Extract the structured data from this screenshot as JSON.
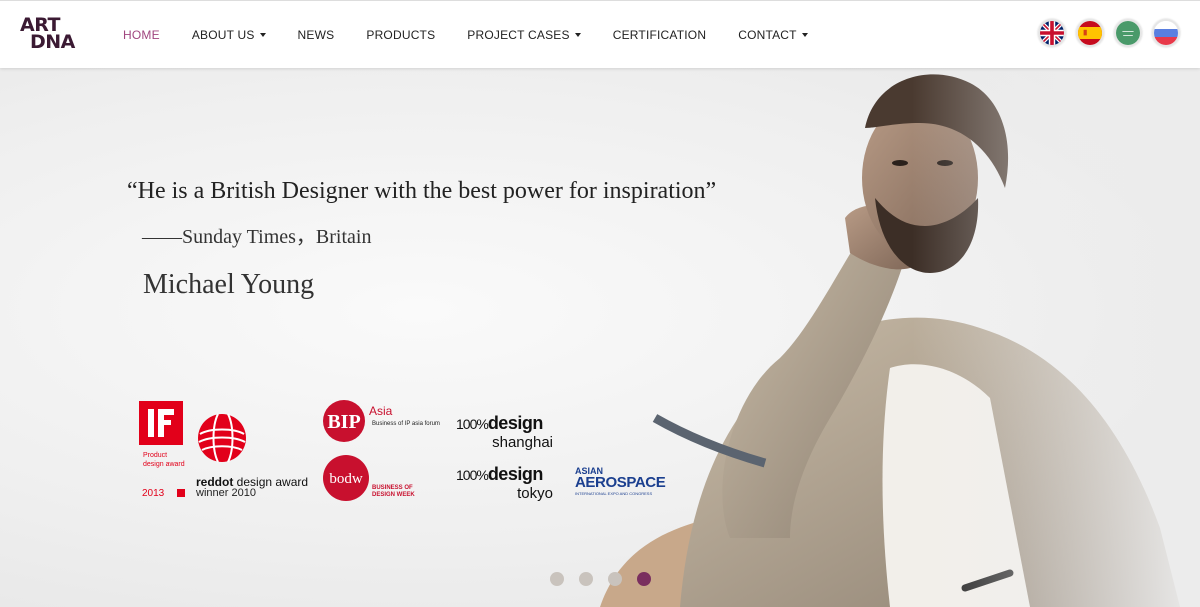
{
  "logo": {
    "line1": "ART",
    "line2": "DNA"
  },
  "nav": {
    "items": [
      {
        "label": "HOME",
        "active": true,
        "dropdown": false
      },
      {
        "label": "ABOUT US",
        "active": false,
        "dropdown": true
      },
      {
        "label": "NEWS",
        "active": false,
        "dropdown": false
      },
      {
        "label": "PRODUCTS",
        "active": false,
        "dropdown": false
      },
      {
        "label": "PROJECT CASES",
        "active": false,
        "dropdown": true
      },
      {
        "label": "CERTIFICATION",
        "active": false,
        "dropdown": false
      },
      {
        "label": "CONTACT",
        "active": false,
        "dropdown": true
      }
    ],
    "active_color": "#a0467f"
  },
  "languages": [
    {
      "name": "uk-flag-icon"
    },
    {
      "name": "spain-flag-icon"
    },
    {
      "name": "saudi-flag-icon"
    },
    {
      "name": "russia-flag-icon"
    }
  ],
  "hero": {
    "quote": "“He is a British Designer with the best power for inspiration”",
    "source": "——Sunday Times，Britain",
    "designer": "Michael Young"
  },
  "awards": {
    "if": {
      "logo": "iF",
      "caption_line1": "Product",
      "caption_line2": "design award",
      "year": "2013"
    },
    "reddot": {
      "title_bold": "reddot",
      "title_rest": " design award",
      "subtitle": "winner 2010"
    },
    "bip": {
      "logo": "BIP",
      "suffix": "Asia",
      "caption": "Business of IP asia forum"
    },
    "bodw": {
      "logo": "bodw",
      "caption_line1": "BUSINESS OF",
      "caption_line2": "DESIGN WEEK"
    },
    "design_shanghai": {
      "prefix": "100%",
      "word": "design",
      "city": "shanghai"
    },
    "design_tokyo": {
      "prefix": "100%",
      "word": "design",
      "city": "tokyo"
    },
    "aerospace": {
      "top": "ASIAN",
      "main": "AEROSPACE",
      "sub": "INTERNATIONAL EXPO AND CONGRESS"
    }
  },
  "carousel": {
    "total": 4,
    "active_index": 3
  },
  "colors": {
    "brand": "#3b1a33",
    "accent": "#7a2f5f",
    "red": "#e2001a"
  }
}
